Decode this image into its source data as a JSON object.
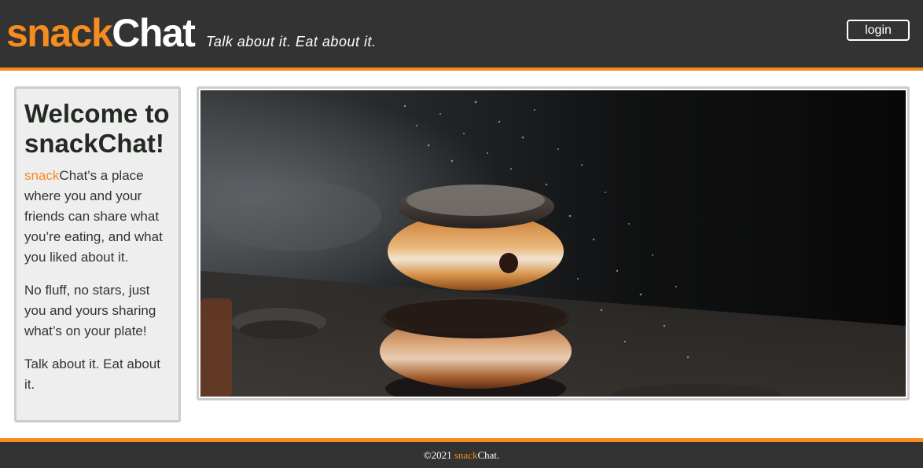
{
  "header": {
    "logo_snack": "snack",
    "logo_chat": "Chat",
    "tagline": "Talk about it. Eat about it.",
    "login_label": "login"
  },
  "sidebar": {
    "title": "Welcome to snackChat!",
    "p1_snack": "snack",
    "p1_rest": "Chat's a place where you and your friends can share what you’re eating, and what you liked about it.",
    "p2": "No fluff, no stars, just you and yours sharing what’s on your plate!",
    "p3": "Talk about it. Eat about it."
  },
  "hero": {
    "image_subject": "stacked chocolate-glazed donuts dusted with powdered sugar"
  },
  "footer": {
    "copyright": "©2021 ",
    "snack": "snack",
    "chat": "Chat."
  },
  "colors": {
    "accent": "#f68b1f",
    "bar": "#333333",
    "sidebar_bg": "#eeeeee",
    "border": "#cccccc"
  }
}
